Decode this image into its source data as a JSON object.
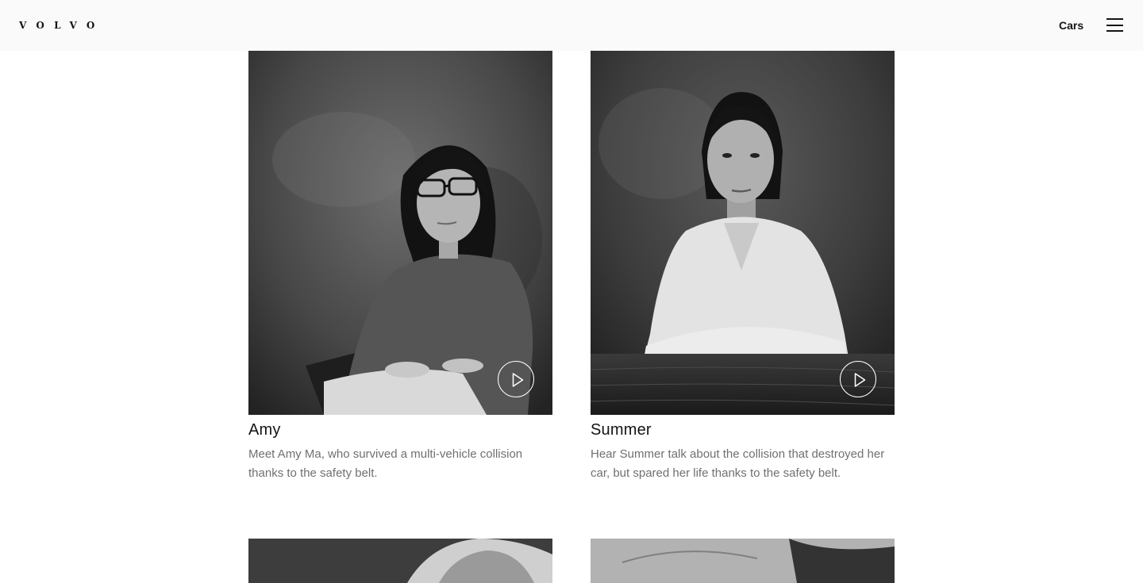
{
  "header": {
    "logo_text": "VOLVO",
    "nav_link": "Cars",
    "menu_icon": "hamburger-menu-icon"
  },
  "stories": [
    {
      "name": "Amy",
      "description": "Meet Amy Ma, who survived a multi-vehicle collision thanks to the safety belt.",
      "play_icon": "play-icon"
    },
    {
      "name": "Summer",
      "description": "Hear Summer talk about the collision that destroyed her car, but spared her life thanks to the safety belt.",
      "play_icon": "play-icon"
    }
  ],
  "colors": {
    "header_bg": "#fafafa",
    "text_primary": "#141414",
    "text_secondary": "#707070"
  }
}
